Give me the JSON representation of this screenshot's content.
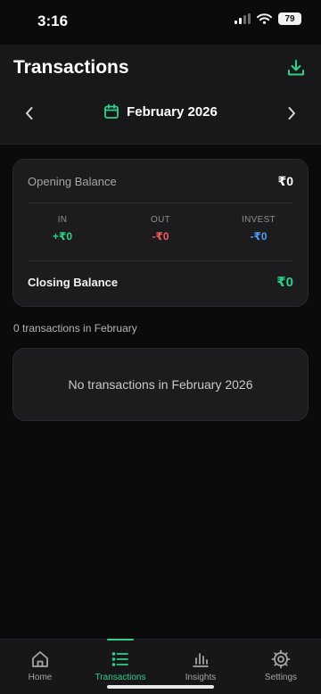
{
  "status_bar": {
    "time": "3:16",
    "battery": "79"
  },
  "header": {
    "title": "Transactions",
    "download_icon": "download-icon"
  },
  "month_nav": {
    "label": "February 2026",
    "prev_icon": "chevron-left-icon",
    "next_icon": "chevron-right-icon",
    "calendar_icon": "calendar-icon"
  },
  "summary": {
    "opening_label": "Opening Balance",
    "opening_value": "₹0",
    "in_label": "IN",
    "in_value": "+₹0",
    "out_label": "OUT",
    "out_value": "-₹0",
    "invest_label": "INVEST",
    "invest_value": "-₹0",
    "closing_label": "Closing Balance",
    "closing_value": "₹0"
  },
  "transactions": {
    "count_text": "0 transactions in February",
    "empty_text": "No transactions in February 2026"
  },
  "tabs": [
    {
      "label": "Home",
      "icon": "home-icon",
      "active": false
    },
    {
      "label": "Transactions",
      "icon": "list-icon",
      "active": true
    },
    {
      "label": "Insights",
      "icon": "bar-chart-icon",
      "active": false
    },
    {
      "label": "Settings",
      "icon": "gear-icon",
      "active": false
    }
  ],
  "colors": {
    "accent": "#2fd08a",
    "out": "#ef5b5b",
    "invest": "#4a9df0",
    "background": "#0b0b0c",
    "card": "#1c1c1e"
  }
}
